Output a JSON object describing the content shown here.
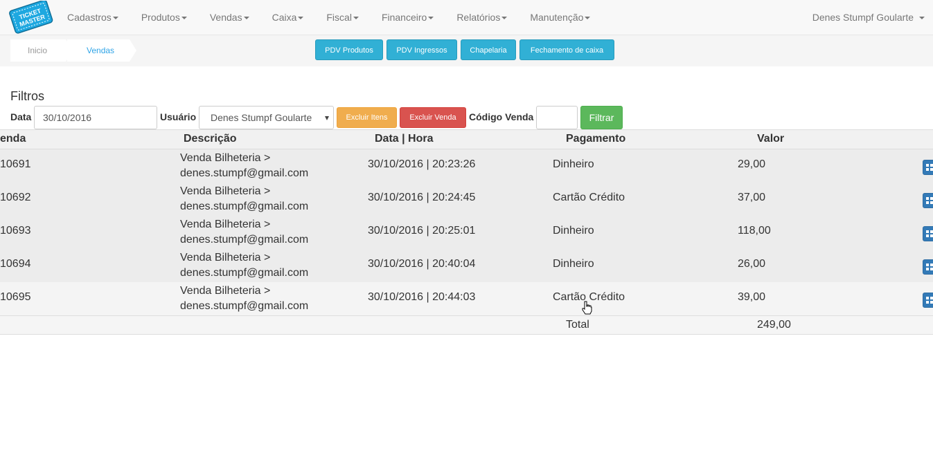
{
  "brand": {
    "logo_text_line1": "TICKET",
    "logo_text_line2": "MASTER",
    "logo_color": "#1ea8e0"
  },
  "nav": {
    "items": [
      {
        "label": "Cadastros"
      },
      {
        "label": "Produtos"
      },
      {
        "label": "Vendas"
      },
      {
        "label": "Caixa"
      },
      {
        "label": "Fiscal"
      },
      {
        "label": "Financeiro"
      },
      {
        "label": "Relatórios"
      },
      {
        "label": "Manutenção"
      }
    ],
    "user": "Denes Stumpf Goularte"
  },
  "breadcrumb": {
    "home": "Inicio",
    "current": "Vendas"
  },
  "quick_actions": {
    "pdv_produtos": "PDV Produtos",
    "pdv_ingressos": "PDV Ingressos",
    "chapelaria": "Chapelaria",
    "fechamento": "Fechamento de caixa"
  },
  "filters": {
    "title": "Filtros",
    "data_label": "Data",
    "data_value": "30/10/2016",
    "usuario_label": "Usuário",
    "usuario_value": "Denes Stumpf Goularte",
    "excluir_itens": "Excluir Itens",
    "excluir_venda": "Excluir Venda",
    "codigo_label": "Código Venda",
    "codigo_value": "",
    "filtrar": "Filtrar"
  },
  "table": {
    "headers": {
      "venda": "enda",
      "descricao": "Descrição",
      "data_hora": "Data | Hora",
      "pagamento": "Pagamento",
      "valor": "Valor"
    },
    "rows": [
      {
        "venda": "10691",
        "desc1": "Venda Bilheteria >",
        "desc2": "denes.stumpf@gmail.com",
        "data_hora": "30/10/2016 | 20:23:26",
        "pagamento": "Dinheiro",
        "valor": "29,00"
      },
      {
        "venda": "10692",
        "desc1": "Venda Bilheteria >",
        "desc2": "denes.stumpf@gmail.com",
        "data_hora": "30/10/2016 | 20:24:45",
        "pagamento": "Cartão Crédito",
        "valor": "37,00"
      },
      {
        "venda": "10693",
        "desc1": "Venda Bilheteria >",
        "desc2": "denes.stumpf@gmail.com",
        "data_hora": "30/10/2016 | 20:25:01",
        "pagamento": "Dinheiro",
        "valor": "118,00"
      },
      {
        "venda": "10694",
        "desc1": "Venda Bilheteria >",
        "desc2": "denes.stumpf@gmail.com",
        "data_hora": "30/10/2016 | 20:40:04",
        "pagamento": "Dinheiro",
        "valor": "26,00"
      },
      {
        "venda": "10695",
        "desc1": "Venda Bilheteria >",
        "desc2": "denes.stumpf@gmail.com",
        "data_hora": "30/10/2016 | 20:44:03",
        "pagamento": "Cartão Crédito",
        "valor": "39,00"
      }
    ],
    "total_label": "Total",
    "total_value": "249,00"
  }
}
